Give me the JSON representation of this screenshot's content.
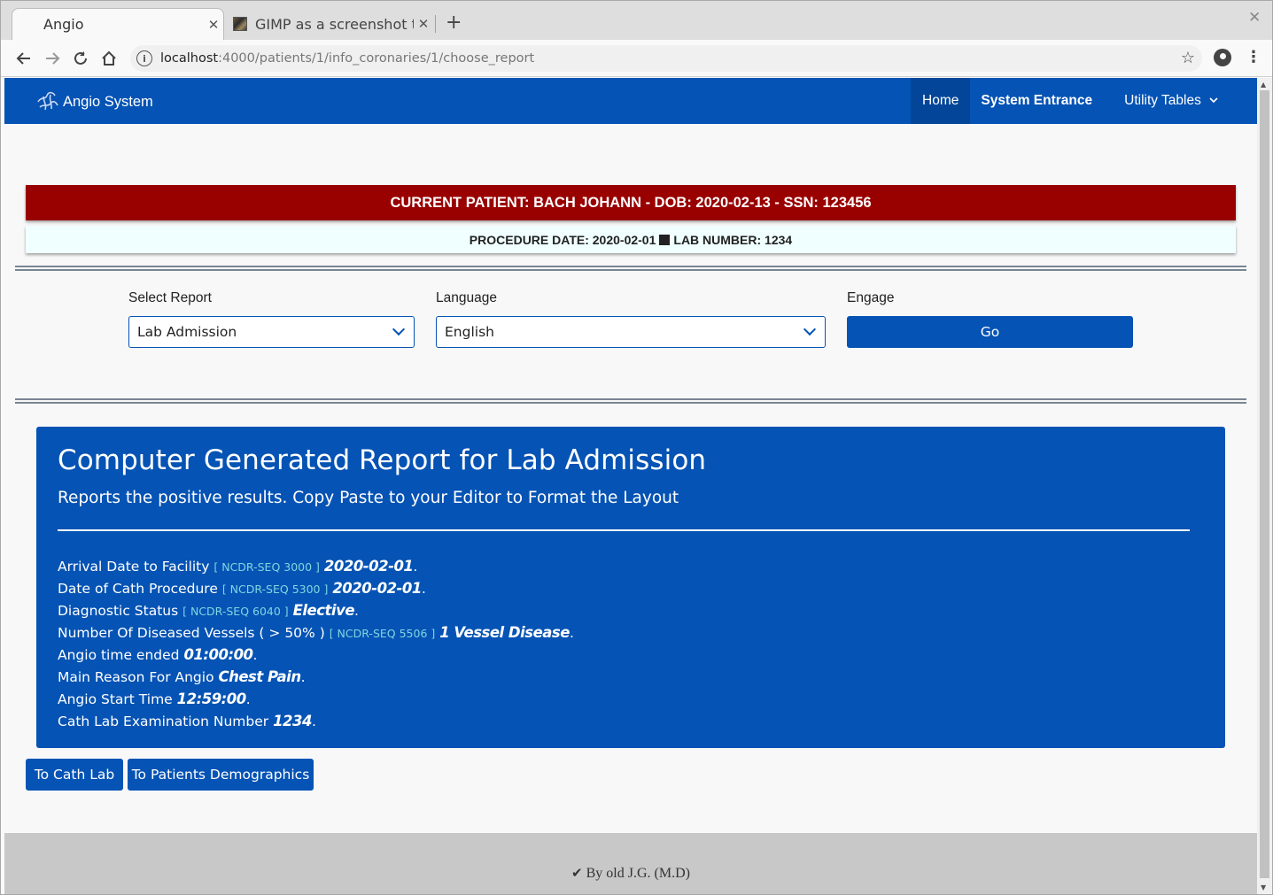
{
  "browser": {
    "tabs": [
      {
        "label": "Angio"
      },
      {
        "label": "GIMP as a screenshot t"
      }
    ],
    "url_host": "localhost",
    "url_path": ":4000/patients/1/info_coronaries/1/choose_report"
  },
  "navbar": {
    "brand": "Angio System",
    "links": {
      "home": "Home",
      "system": "System Entrance",
      "utility": "Utility Tables"
    }
  },
  "patient": {
    "banner": "CURRENT PATIENT: BACH JOHANN - DOB: 2020-02-13 - SSN: 123456",
    "procedure_date": "PROCEDURE DATE: 2020-02-01",
    "lab_number": "LAB NUMBER: 1234"
  },
  "form": {
    "report_label": "Select Report",
    "report_value": "Lab Admission",
    "language_label": "Language",
    "language_value": "English",
    "engage_label": "Engage",
    "go_label": "Go"
  },
  "report": {
    "title": "Computer Generated Report for Lab Admission",
    "subtitle": "Reports the positive results. Copy Paste to your Editor to Format the Layout",
    "lines": [
      {
        "label": "Arrival Date to Facility",
        "seq": "[ NCDR-SEQ 3000 ]",
        "value": "2020-02-01"
      },
      {
        "label": "Date of Cath Procedure",
        "seq": "[ NCDR-SEQ 5300 ]",
        "value": "2020-02-01"
      },
      {
        "label": "Diagnostic Status",
        "seq": "[ NCDR-SEQ 6040 ]",
        "value": "Elective"
      },
      {
        "label": "Number Of Diseased Vessels ( > 50% )",
        "seq": "[ NCDR-SEQ 5506 ]",
        "value": "1 Vessel Disease"
      },
      {
        "label": "Angio time ended",
        "seq": "",
        "value": "01:00:00"
      },
      {
        "label": "Main Reason For Angio",
        "seq": "",
        "value": "Chest Pain"
      },
      {
        "label": "Angio Start Time",
        "seq": "",
        "value": "12:59:00"
      },
      {
        "label": "Cath Lab Examination Number",
        "seq": "",
        "value": "1234"
      }
    ]
  },
  "buttons": {
    "cath_lab": "To Cath Lab",
    "demographics": "To Patients Demographics"
  },
  "footer": {
    "text": "By old J.G. (M.D)"
  },
  "colors": {
    "primary": "#0553b4",
    "banner": "#990000",
    "procedure_bg": "#f0ffff",
    "seq": "#7fd6e0"
  },
  "icons": [
    "back-icon",
    "forward-icon",
    "reload-icon",
    "home-icon",
    "info-icon",
    "star-icon",
    "profile-icon",
    "menu-icon",
    "check-icon",
    "chevron-down-icon"
  ]
}
